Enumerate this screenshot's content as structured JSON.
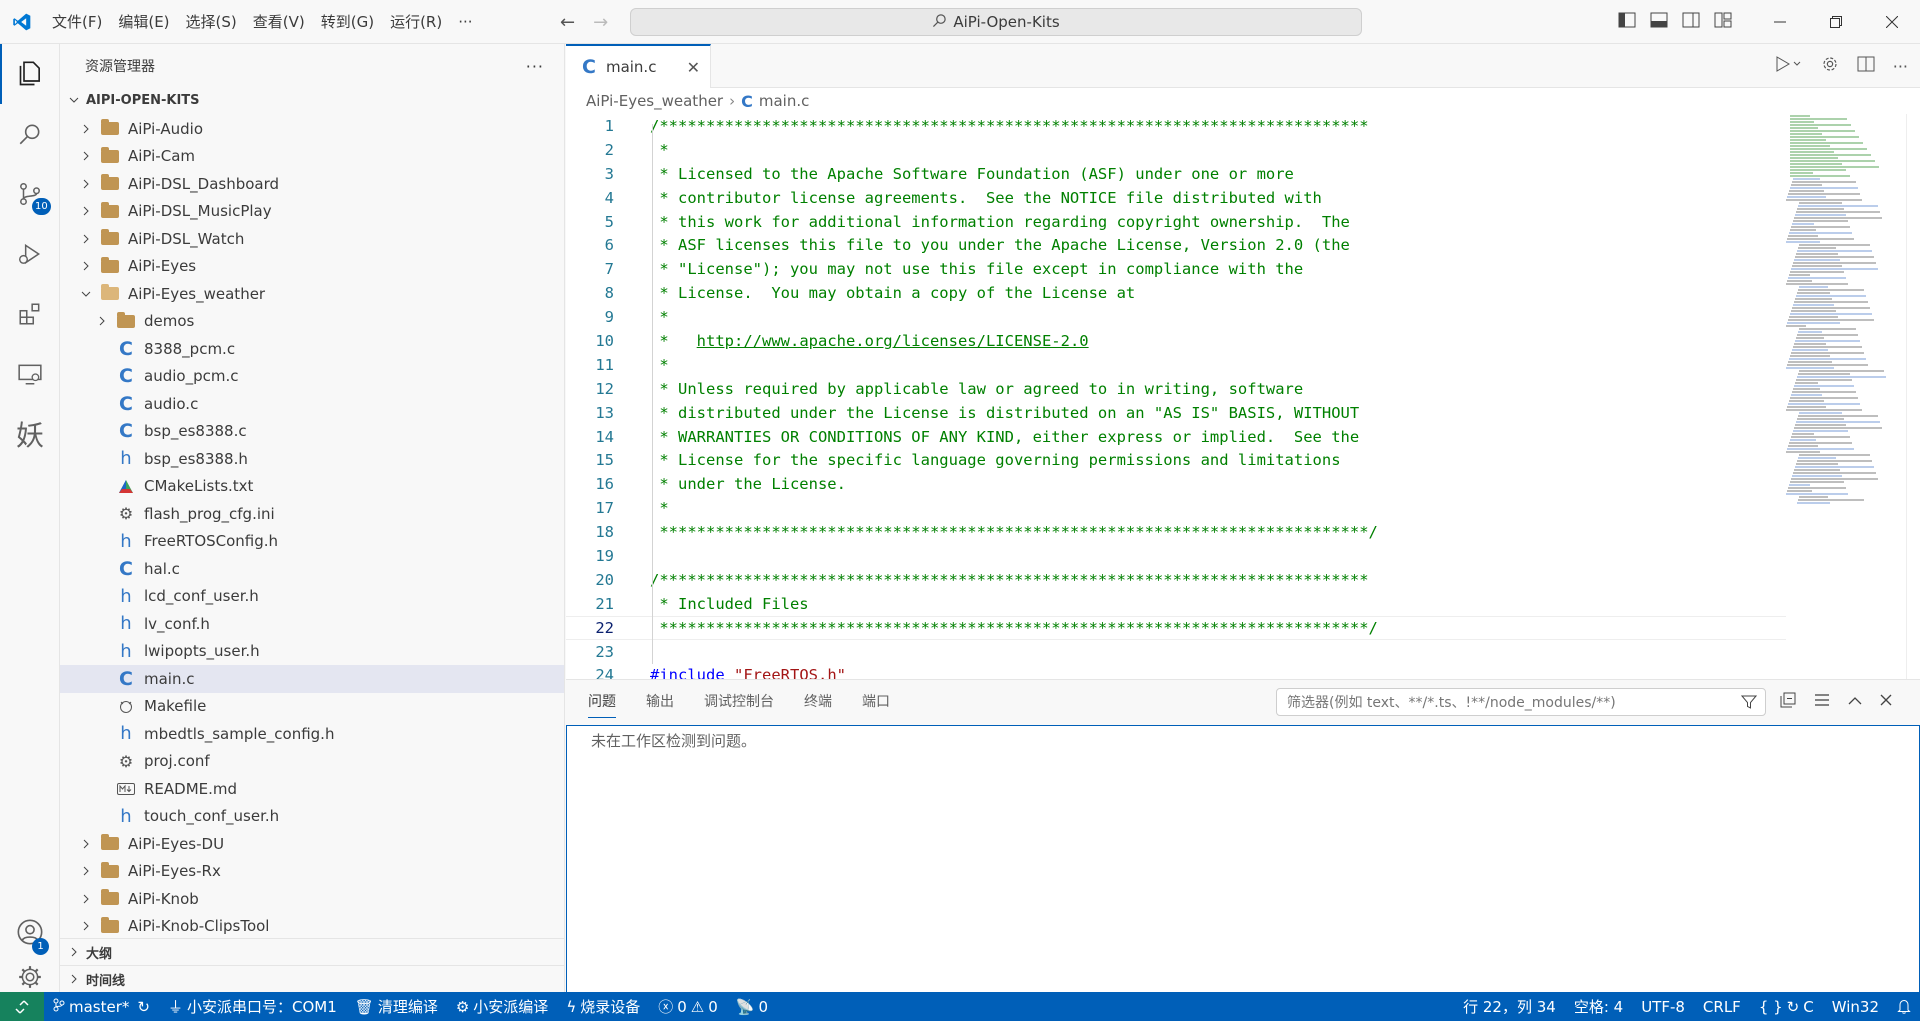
{
  "titlebar": {
    "menus": [
      "文件(F)",
      "编辑(E)",
      "选择(S)",
      "查看(V)",
      "转到(G)",
      "运行(R)",
      "···"
    ],
    "search_text": "AiPi-Open-Kits"
  },
  "activity": {
    "scm_badge": "10",
    "accounts_badge": "1",
    "custom_glyph": "妖"
  },
  "sidebar": {
    "title": "资源管理器",
    "more": "···",
    "root": "AIPI-OPEN-KITS",
    "items": [
      {
        "label": "AiPi-Audio",
        "type": "folder",
        "level": 1
      },
      {
        "label": "AiPi-Cam",
        "type": "folder",
        "level": 1
      },
      {
        "label": "AiPi-DSL_Dashboard",
        "type": "folder",
        "level": 1
      },
      {
        "label": "AiPi-DSL_MusicPlay",
        "type": "folder",
        "level": 1
      },
      {
        "label": "AiPi-DSL_Watch",
        "type": "folder",
        "level": 1
      },
      {
        "label": "AiPi-Eyes",
        "type": "folder",
        "level": 1
      },
      {
        "label": "AiPi-Eyes_weather",
        "type": "folder-open",
        "level": 1
      },
      {
        "label": "demos",
        "type": "folder",
        "level": 2
      },
      {
        "label": "8388_pcm.c",
        "type": "c",
        "level": 2
      },
      {
        "label": "audio_pcm.c",
        "type": "c",
        "level": 2
      },
      {
        "label": "audio.c",
        "type": "c",
        "level": 2
      },
      {
        "label": "bsp_es8388.c",
        "type": "c",
        "level": 2
      },
      {
        "label": "bsp_es8388.h",
        "type": "h",
        "level": 2
      },
      {
        "label": "CMakeLists.txt",
        "type": "cmake",
        "level": 2
      },
      {
        "label": "flash_prog_cfg.ini",
        "type": "gear",
        "level": 2
      },
      {
        "label": "FreeRTOSConfig.h",
        "type": "h",
        "level": 2
      },
      {
        "label": "hal.c",
        "type": "c",
        "level": 2
      },
      {
        "label": "lcd_conf_user.h",
        "type": "h",
        "level": 2
      },
      {
        "label": "lv_conf.h",
        "type": "h",
        "level": 2
      },
      {
        "label": "lwipopts_user.h",
        "type": "h",
        "level": 2
      },
      {
        "label": "main.c",
        "type": "c",
        "level": 2,
        "selected": true
      },
      {
        "label": "Makefile",
        "type": "make",
        "level": 2
      },
      {
        "label": "mbedtls_sample_config.h",
        "type": "h",
        "level": 2
      },
      {
        "label": "proj.conf",
        "type": "gear",
        "level": 2
      },
      {
        "label": "README.md",
        "type": "md",
        "level": 2
      },
      {
        "label": "touch_conf_user.h",
        "type": "h",
        "level": 2
      },
      {
        "label": "AiPi-Eyes-DU",
        "type": "folder",
        "level": 1
      },
      {
        "label": "AiPi-Eyes-Rx",
        "type": "folder",
        "level": 1
      },
      {
        "label": "AiPi-Knob",
        "type": "folder",
        "level": 1
      },
      {
        "label": "AiPi-Knob-ClipsTool",
        "type": "folder",
        "level": 1
      }
    ],
    "outline": "大纲",
    "timeline": "时间线"
  },
  "editor": {
    "tab_label": "main.c",
    "breadcrumb": [
      "AiPi-Eyes_weather",
      "main.c"
    ],
    "current_line": 22,
    "lines": [
      "/****************************************************************************",
      " *",
      " * Licensed to the Apache Software Foundation (ASF) under one or more",
      " * contributor license agreements.  See the NOTICE file distributed with",
      " * this work for additional information regarding copyright ownership.  The",
      " * ASF licenses this file to you under the Apache License, Version 2.0 (the",
      " * \"License\"); you may not use this file except in compliance with the",
      " * License.  You may obtain a copy of the License at",
      " *",
      " *   http://www.apache.org/licenses/LICENSE-2.0",
      " *",
      " * Unless required by applicable law or agreed to in writing, software",
      " * distributed under the License is distributed on an \"AS IS\" BASIS, WITHOUT",
      " * WARRANTIES OR CONDITIONS OF ANY KIND, either express or implied.  See the",
      " * License for the specific language governing permissions and limitations",
      " * under the License.",
      " *",
      " ****************************************************************************/",
      "",
      "/****************************************************************************",
      " * Included Files",
      " ****************************************************************************/",
      "",
      "#include \"FreeRTOS.h\""
    ]
  },
  "panel": {
    "tabs": [
      "问题",
      "输出",
      "调试控制台",
      "终端",
      "端口"
    ],
    "filter_placeholder": "筛选器(例如 text、**/*.ts、!**/node_modules/**)",
    "message": "未在工作区检测到问题。"
  },
  "status": {
    "branch": "master*",
    "serial": "小安派串口号：COM1",
    "clean": "清理编译",
    "build": "小安派编译",
    "flash": "烧录设备",
    "errors": "0",
    "warnings": "0",
    "ports": "0",
    "position": "行 22，列 34",
    "spaces": "空格: 4",
    "encoding": "UTF-8",
    "eol": "CRLF",
    "language": "C",
    "platform": "Win32"
  }
}
